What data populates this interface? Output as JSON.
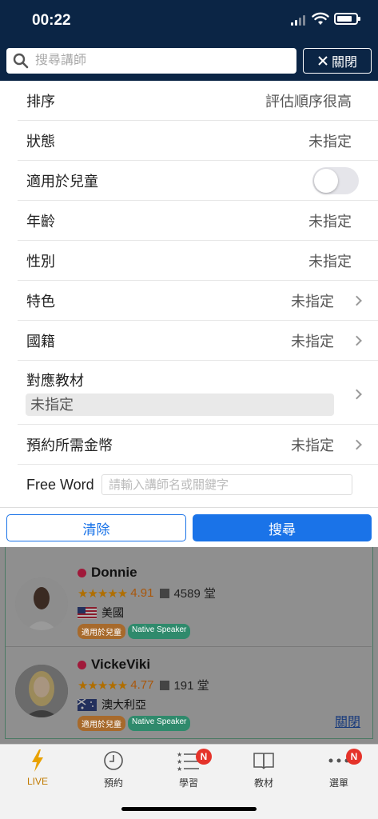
{
  "status_bar": {
    "time": "00:22"
  },
  "header": {
    "search_placeholder": "搜尋講師",
    "close_label": "關閉"
  },
  "filters": {
    "sort": {
      "label": "排序",
      "value": "評估順序很高"
    },
    "status": {
      "label": "狀態",
      "value": "未指定"
    },
    "kids": {
      "label": "適用於兒童",
      "enabled": false
    },
    "age": {
      "label": "年齡",
      "value": "未指定"
    },
    "gender": {
      "label": "性別",
      "value": "未指定"
    },
    "features": {
      "label": "特色",
      "value": "未指定"
    },
    "nationality": {
      "label": "國籍",
      "value": "未指定"
    },
    "material": {
      "label": "對應教材",
      "value": "未指定"
    },
    "coins": {
      "label": "預約所需金幣",
      "value": "未指定"
    },
    "freeword": {
      "label": "Free Word",
      "placeholder": "請輸入講師名或關鍵字"
    }
  },
  "actions": {
    "clear": "清除",
    "search": "搜尋"
  },
  "teachers": [
    {
      "name": "Donnie",
      "stars": "★★★★★",
      "rating": "4.91",
      "lessons": "4589 堂",
      "country": "美國",
      "tag_kids": "適用於兒童",
      "tag_native": "Native Speaker"
    },
    {
      "name": "VickeViki",
      "stars": "★★★★★",
      "rating": "4.77",
      "lessons": "191 堂",
      "country": "澳大利亞",
      "tag_kids": "適用於兒童",
      "tag_native": "Native Speaker"
    }
  ],
  "list_close_link": "關閉",
  "tabbar": {
    "items": [
      {
        "label": "LIVE",
        "icon": "lightning-icon",
        "active": true
      },
      {
        "label": "預約",
        "icon": "clock-icon"
      },
      {
        "label": "學習",
        "icon": "checklist-icon",
        "badge": "N"
      },
      {
        "label": "教材",
        "icon": "book-icon"
      },
      {
        "label": "選單",
        "icon": "more-dots-icon",
        "badge": "N"
      }
    ]
  },
  "colors": {
    "header_bg": "#0b2545",
    "primary": "#1a73e8",
    "accent": "#c07a00",
    "badge": "#e5332a"
  }
}
